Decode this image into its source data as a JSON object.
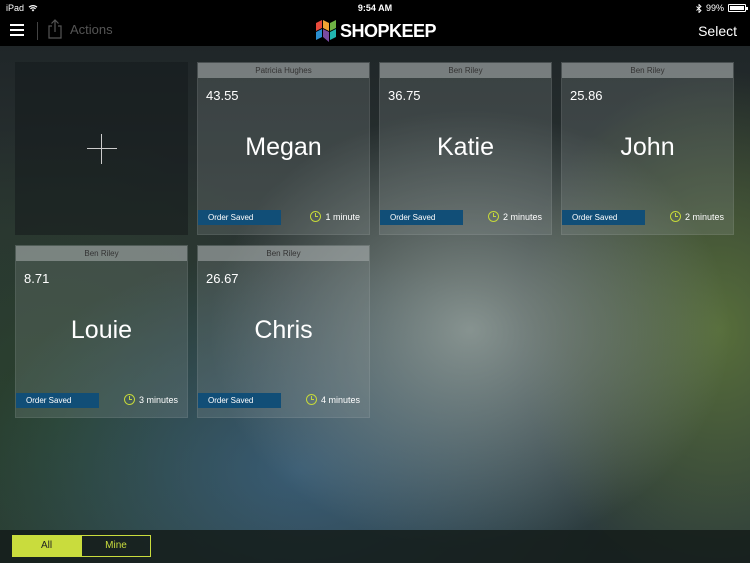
{
  "statusbar": {
    "device": "iPad",
    "time": "9:54 AM",
    "battery": "99%"
  },
  "navbar": {
    "actions_label": "Actions",
    "logo_text": "SHOPKEEP",
    "select_label": "Select"
  },
  "orders": [
    {
      "employee": "Patricia Hughes",
      "amount": "43.55",
      "name": "Megan",
      "status": "Order Saved",
      "time": "1 minute"
    },
    {
      "employee": "Ben Riley",
      "amount": "36.75",
      "name": "Katie",
      "status": "Order Saved",
      "time": "2 minutes"
    },
    {
      "employee": "Ben Riley",
      "amount": "25.86",
      "name": "John",
      "status": "Order Saved",
      "time": "2 minutes"
    },
    {
      "employee": "Ben Riley",
      "amount": "8.71",
      "name": "Louie",
      "status": "Order Saved",
      "time": "3 minutes"
    },
    {
      "employee": "Ben Riley",
      "amount": "26.67",
      "name": "Chris",
      "status": "Order Saved",
      "time": "4 minutes"
    }
  ],
  "filter": {
    "all_label": "All",
    "mine_label": "Mine",
    "selected": "All"
  },
  "colors": {
    "accent": "#c9dc3d",
    "status_bg": "#114e77"
  }
}
